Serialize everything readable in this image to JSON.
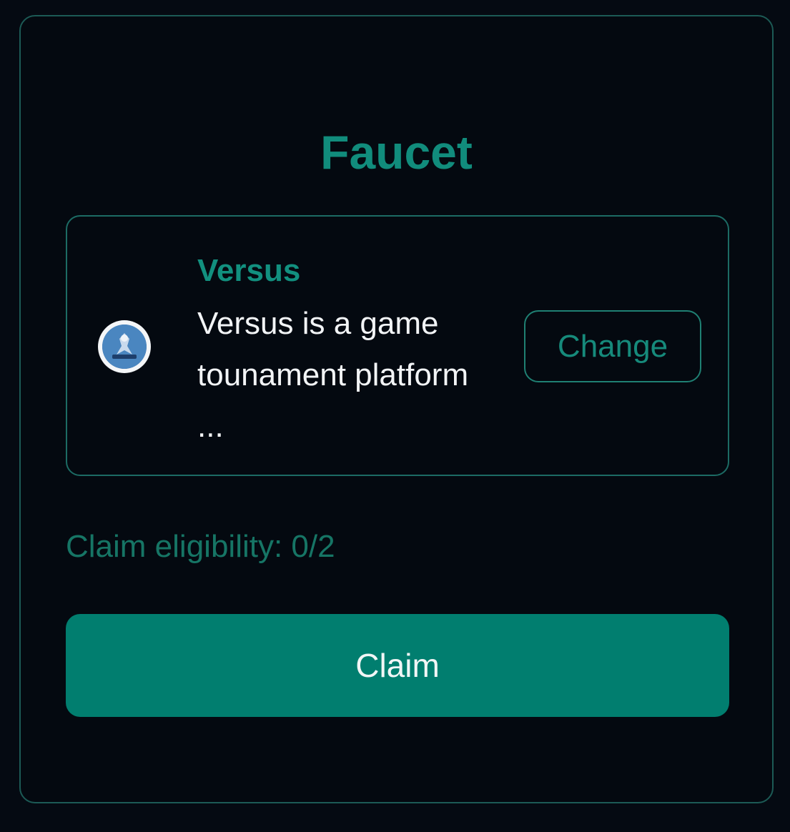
{
  "faucet": {
    "title": "Faucet",
    "project": {
      "name": "Versus",
      "description": "Versus is a game tounament platform ...",
      "avatar_icon": "versus-logo-icon",
      "change_label": "Change"
    },
    "eligibility_label": "Claim eligibility: 0/2",
    "claim_label": "Claim"
  },
  "colors": {
    "accent": "#118c7c",
    "button": "#017e6f",
    "background": "#040910",
    "border": "#1c5a55"
  }
}
